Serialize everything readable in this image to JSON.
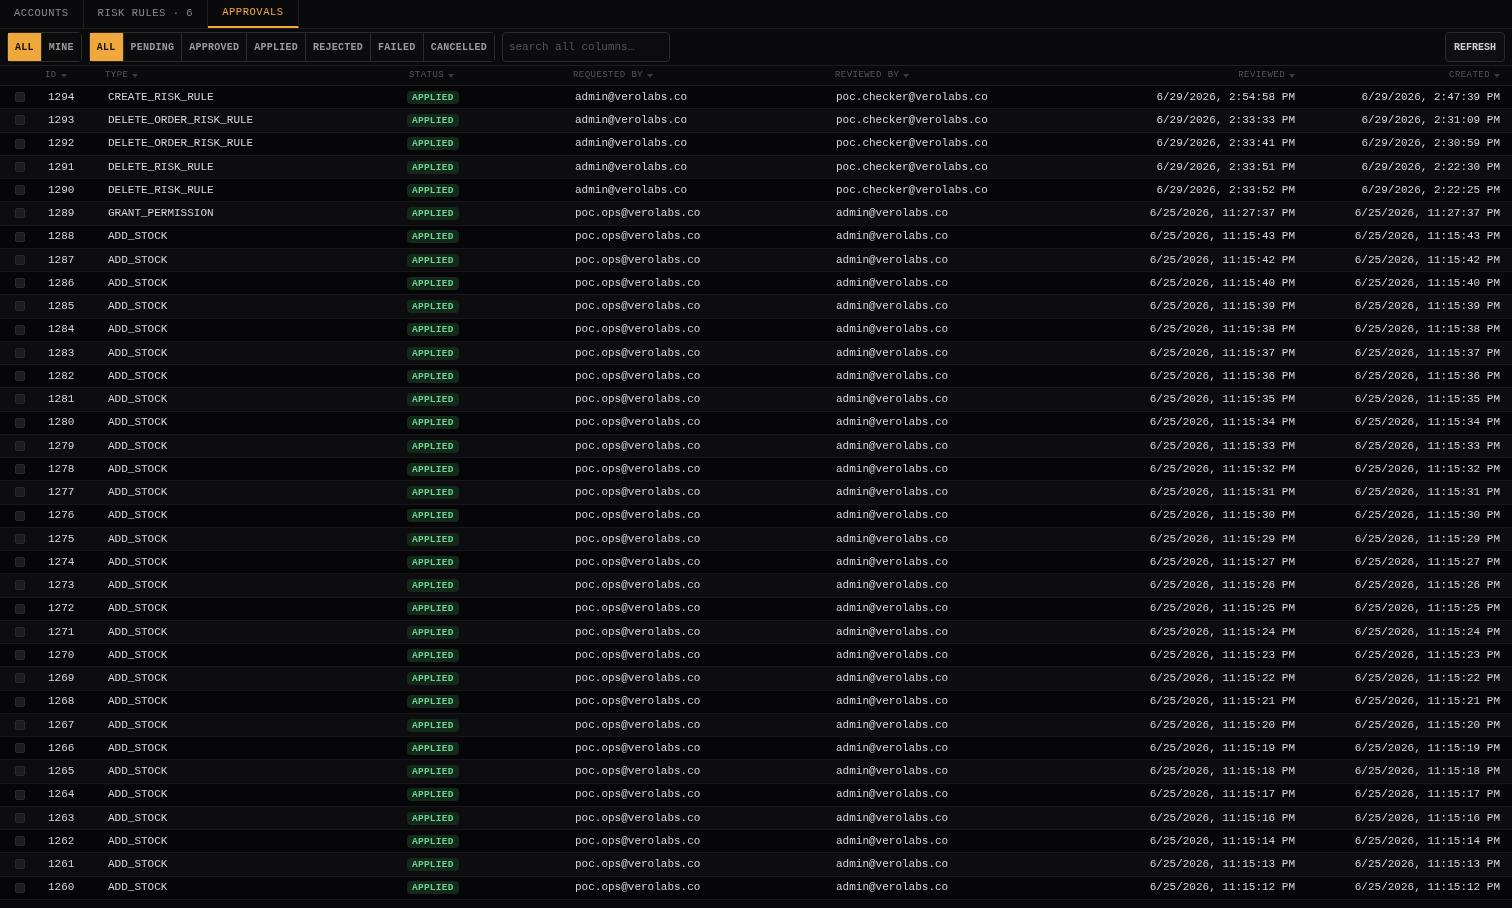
{
  "tabs": [
    {
      "label": "ACCOUNTS",
      "selected": false
    },
    {
      "label": "RISK RULES · 6",
      "selected": false
    },
    {
      "label": "APPROVALS",
      "selected": true
    }
  ],
  "scope_filters": [
    {
      "label": "ALL",
      "selected": true
    },
    {
      "label": "MINE",
      "selected": false
    }
  ],
  "status_filters": [
    {
      "label": "ALL",
      "selected": true
    },
    {
      "label": "PENDING",
      "selected": false
    },
    {
      "label": "APPROVED",
      "selected": false
    },
    {
      "label": "APPLIED",
      "selected": false
    },
    {
      "label": "REJECTED",
      "selected": false
    },
    {
      "label": "FAILED",
      "selected": false
    },
    {
      "label": "CANCELLED",
      "selected": false
    }
  ],
  "search": {
    "placeholder": "search all columns…"
  },
  "refresh_button": "REFRESH",
  "table": {
    "columns": [
      "ID",
      "TYPE",
      "STATUS",
      "REQUESTED BY",
      "REVIEWED BY",
      "REVIEWED",
      "CREATED"
    ],
    "rows": [
      {
        "checked": false,
        "id": "1294",
        "type": "CREATE_RISK_RULE",
        "status": "APPLIED",
        "requested_by": "admin@verolabs.co",
        "reviewed_by": "poc.checker@verolabs.co",
        "reviewed": "6/29/2026, 2:54:58 PM",
        "created": "6/29/2026, 2:47:39 PM"
      },
      {
        "checked": false,
        "id": "1293",
        "type": "DELETE_ORDER_RISK_RULE",
        "status": "APPLIED",
        "requested_by": "admin@verolabs.co",
        "reviewed_by": "poc.checker@verolabs.co",
        "reviewed": "6/29/2026, 2:33:33 PM",
        "created": "6/29/2026, 2:31:09 PM"
      },
      {
        "checked": false,
        "id": "1292",
        "type": "DELETE_ORDER_RISK_RULE",
        "status": "APPLIED",
        "requested_by": "admin@verolabs.co",
        "reviewed_by": "poc.checker@verolabs.co",
        "reviewed": "6/29/2026, 2:33:41 PM",
        "created": "6/29/2026, 2:30:59 PM"
      },
      {
        "checked": false,
        "id": "1291",
        "type": "DELETE_RISK_RULE",
        "status": "APPLIED",
        "requested_by": "admin@verolabs.co",
        "reviewed_by": "poc.checker@verolabs.co",
        "reviewed": "6/29/2026, 2:33:51 PM",
        "created": "6/29/2026, 2:22:30 PM"
      },
      {
        "checked": false,
        "id": "1290",
        "type": "DELETE_RISK_RULE",
        "status": "APPLIED",
        "requested_by": "admin@verolabs.co",
        "reviewed_by": "poc.checker@verolabs.co",
        "reviewed": "6/29/2026, 2:33:52 PM",
        "created": "6/29/2026, 2:22:25 PM"
      },
      {
        "checked": false,
        "id": "1289",
        "type": "GRANT_PERMISSION",
        "status": "APPLIED",
        "requested_by": "poc.ops@verolabs.co",
        "reviewed_by": "admin@verolabs.co",
        "reviewed": "6/25/2026, 11:27:37 PM",
        "created": "6/25/2026, 11:27:37 PM"
      },
      {
        "checked": false,
        "id": "1288",
        "type": "ADD_STOCK",
        "status": "APPLIED",
        "requested_by": "poc.ops@verolabs.co",
        "reviewed_by": "admin@verolabs.co",
        "reviewed": "6/25/2026, 11:15:43 PM",
        "created": "6/25/2026, 11:15:43 PM"
      },
      {
        "checked": false,
        "id": "1287",
        "type": "ADD_STOCK",
        "status": "APPLIED",
        "requested_by": "poc.ops@verolabs.co",
        "reviewed_by": "admin@verolabs.co",
        "reviewed": "6/25/2026, 11:15:42 PM",
        "created": "6/25/2026, 11:15:42 PM"
      },
      {
        "checked": false,
        "id": "1286",
        "type": "ADD_STOCK",
        "status": "APPLIED",
        "requested_by": "poc.ops@verolabs.co",
        "reviewed_by": "admin@verolabs.co",
        "reviewed": "6/25/2026, 11:15:40 PM",
        "created": "6/25/2026, 11:15:40 PM"
      },
      {
        "checked": false,
        "id": "1285",
        "type": "ADD_STOCK",
        "status": "APPLIED",
        "requested_by": "poc.ops@verolabs.co",
        "reviewed_by": "admin@verolabs.co",
        "reviewed": "6/25/2026, 11:15:39 PM",
        "created": "6/25/2026, 11:15:39 PM"
      },
      {
        "checked": false,
        "id": "1284",
        "type": "ADD_STOCK",
        "status": "APPLIED",
        "requested_by": "poc.ops@verolabs.co",
        "reviewed_by": "admin@verolabs.co",
        "reviewed": "6/25/2026, 11:15:38 PM",
        "created": "6/25/2026, 11:15:38 PM"
      },
      {
        "checked": false,
        "id": "1283",
        "type": "ADD_STOCK",
        "status": "APPLIED",
        "requested_by": "poc.ops@verolabs.co",
        "reviewed_by": "admin@verolabs.co",
        "reviewed": "6/25/2026, 11:15:37 PM",
        "created": "6/25/2026, 11:15:37 PM"
      },
      {
        "checked": false,
        "id": "1282",
        "type": "ADD_STOCK",
        "status": "APPLIED",
        "requested_by": "poc.ops@verolabs.co",
        "reviewed_by": "admin@verolabs.co",
        "reviewed": "6/25/2026, 11:15:36 PM",
        "created": "6/25/2026, 11:15:36 PM"
      },
      {
        "checked": false,
        "id": "1281",
        "type": "ADD_STOCK",
        "status": "APPLIED",
        "requested_by": "poc.ops@verolabs.co",
        "reviewed_by": "admin@verolabs.co",
        "reviewed": "6/25/2026, 11:15:35 PM",
        "created": "6/25/2026, 11:15:35 PM"
      },
      {
        "checked": false,
        "id": "1280",
        "type": "ADD_STOCK",
        "status": "APPLIED",
        "requested_by": "poc.ops@verolabs.co",
        "reviewed_by": "admin@verolabs.co",
        "reviewed": "6/25/2026, 11:15:34 PM",
        "created": "6/25/2026, 11:15:34 PM"
      },
      {
        "checked": false,
        "id": "1279",
        "type": "ADD_STOCK",
        "status": "APPLIED",
        "requested_by": "poc.ops@verolabs.co",
        "reviewed_by": "admin@verolabs.co",
        "reviewed": "6/25/2026, 11:15:33 PM",
        "created": "6/25/2026, 11:15:33 PM"
      },
      {
        "checked": false,
        "id": "1278",
        "type": "ADD_STOCK",
        "status": "APPLIED",
        "requested_by": "poc.ops@verolabs.co",
        "reviewed_by": "admin@verolabs.co",
        "reviewed": "6/25/2026, 11:15:32 PM",
        "created": "6/25/2026, 11:15:32 PM"
      },
      {
        "checked": false,
        "id": "1277",
        "type": "ADD_STOCK",
        "status": "APPLIED",
        "requested_by": "poc.ops@verolabs.co",
        "reviewed_by": "admin@verolabs.co",
        "reviewed": "6/25/2026, 11:15:31 PM",
        "created": "6/25/2026, 11:15:31 PM"
      },
      {
        "checked": false,
        "id": "1276",
        "type": "ADD_STOCK",
        "status": "APPLIED",
        "requested_by": "poc.ops@verolabs.co",
        "reviewed_by": "admin@verolabs.co",
        "reviewed": "6/25/2026, 11:15:30 PM",
        "created": "6/25/2026, 11:15:30 PM"
      },
      {
        "checked": false,
        "id": "1275",
        "type": "ADD_STOCK",
        "status": "APPLIED",
        "requested_by": "poc.ops@verolabs.co",
        "reviewed_by": "admin@verolabs.co",
        "reviewed": "6/25/2026, 11:15:29 PM",
        "created": "6/25/2026, 11:15:29 PM"
      },
      {
        "checked": false,
        "id": "1274",
        "type": "ADD_STOCK",
        "status": "APPLIED",
        "requested_by": "poc.ops@verolabs.co",
        "reviewed_by": "admin@verolabs.co",
        "reviewed": "6/25/2026, 11:15:27 PM",
        "created": "6/25/2026, 11:15:27 PM"
      },
      {
        "checked": false,
        "id": "1273",
        "type": "ADD_STOCK",
        "status": "APPLIED",
        "requested_by": "poc.ops@verolabs.co",
        "reviewed_by": "admin@verolabs.co",
        "reviewed": "6/25/2026, 11:15:26 PM",
        "created": "6/25/2026, 11:15:26 PM"
      },
      {
        "checked": false,
        "id": "1272",
        "type": "ADD_STOCK",
        "status": "APPLIED",
        "requested_by": "poc.ops@verolabs.co",
        "reviewed_by": "admin@verolabs.co",
        "reviewed": "6/25/2026, 11:15:25 PM",
        "created": "6/25/2026, 11:15:25 PM"
      },
      {
        "checked": false,
        "id": "1271",
        "type": "ADD_STOCK",
        "status": "APPLIED",
        "requested_by": "poc.ops@verolabs.co",
        "reviewed_by": "admin@verolabs.co",
        "reviewed": "6/25/2026, 11:15:24 PM",
        "created": "6/25/2026, 11:15:24 PM"
      },
      {
        "checked": false,
        "id": "1270",
        "type": "ADD_STOCK",
        "status": "APPLIED",
        "requested_by": "poc.ops@verolabs.co",
        "reviewed_by": "admin@verolabs.co",
        "reviewed": "6/25/2026, 11:15:23 PM",
        "created": "6/25/2026, 11:15:23 PM"
      },
      {
        "checked": false,
        "id": "1269",
        "type": "ADD_STOCK",
        "status": "APPLIED",
        "requested_by": "poc.ops@verolabs.co",
        "reviewed_by": "admin@verolabs.co",
        "reviewed": "6/25/2026, 11:15:22 PM",
        "created": "6/25/2026, 11:15:22 PM"
      },
      {
        "checked": false,
        "id": "1268",
        "type": "ADD_STOCK",
        "status": "APPLIED",
        "requested_by": "poc.ops@verolabs.co",
        "reviewed_by": "admin@verolabs.co",
        "reviewed": "6/25/2026, 11:15:21 PM",
        "created": "6/25/2026, 11:15:21 PM"
      },
      {
        "checked": false,
        "id": "1267",
        "type": "ADD_STOCK",
        "status": "APPLIED",
        "requested_by": "poc.ops@verolabs.co",
        "reviewed_by": "admin@verolabs.co",
        "reviewed": "6/25/2026, 11:15:20 PM",
        "created": "6/25/2026, 11:15:20 PM"
      },
      {
        "checked": false,
        "id": "1266",
        "type": "ADD_STOCK",
        "status": "APPLIED",
        "requested_by": "poc.ops@verolabs.co",
        "reviewed_by": "admin@verolabs.co",
        "reviewed": "6/25/2026, 11:15:19 PM",
        "created": "6/25/2026, 11:15:19 PM"
      },
      {
        "checked": false,
        "id": "1265",
        "type": "ADD_STOCK",
        "status": "APPLIED",
        "requested_by": "poc.ops@verolabs.co",
        "reviewed_by": "admin@verolabs.co",
        "reviewed": "6/25/2026, 11:15:18 PM",
        "created": "6/25/2026, 11:15:18 PM"
      },
      {
        "checked": false,
        "id": "1264",
        "type": "ADD_STOCK",
        "status": "APPLIED",
        "requested_by": "poc.ops@verolabs.co",
        "reviewed_by": "admin@verolabs.co",
        "reviewed": "6/25/2026, 11:15:17 PM",
        "created": "6/25/2026, 11:15:17 PM"
      },
      {
        "checked": false,
        "id": "1263",
        "type": "ADD_STOCK",
        "status": "APPLIED",
        "requested_by": "poc.ops@verolabs.co",
        "reviewed_by": "admin@verolabs.co",
        "reviewed": "6/25/2026, 11:15:16 PM",
        "created": "6/25/2026, 11:15:16 PM"
      },
      {
        "checked": false,
        "id": "1262",
        "type": "ADD_STOCK",
        "status": "APPLIED",
        "requested_by": "poc.ops@verolabs.co",
        "reviewed_by": "admin@verolabs.co",
        "reviewed": "6/25/2026, 11:15:14 PM",
        "created": "6/25/2026, 11:15:14 PM"
      },
      {
        "checked": false,
        "id": "1261",
        "type": "ADD_STOCK",
        "status": "APPLIED",
        "requested_by": "poc.ops@verolabs.co",
        "reviewed_by": "admin@verolabs.co",
        "reviewed": "6/25/2026, 11:15:13 PM",
        "created": "6/25/2026, 11:15:13 PM"
      },
      {
        "checked": false,
        "id": "1260",
        "type": "ADD_STOCK",
        "status": "APPLIED",
        "requested_by": "poc.ops@verolabs.co",
        "reviewed_by": "admin@verolabs.co",
        "reviewed": "6/25/2026, 11:15:12 PM",
        "created": "6/25/2026, 11:15:12 PM"
      }
    ]
  }
}
